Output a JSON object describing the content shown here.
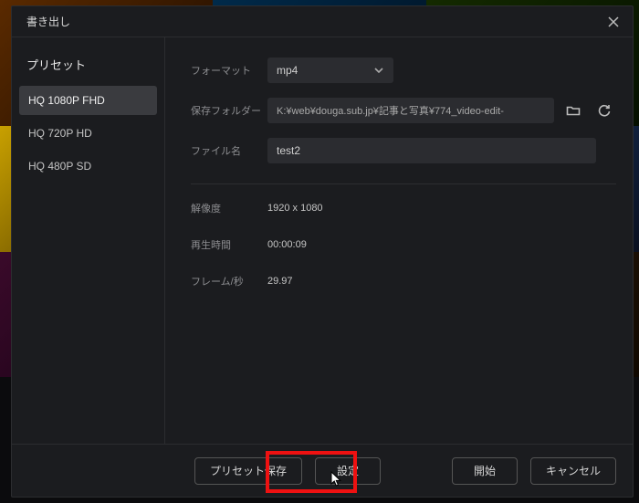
{
  "title": "書き出し",
  "sidebar": {
    "title": "プリセット",
    "presets": [
      {
        "label": "HQ 1080P FHD",
        "selected": true
      },
      {
        "label": "HQ 720P HD",
        "selected": false
      },
      {
        "label": "HQ 480P SD",
        "selected": false
      }
    ]
  },
  "form": {
    "format": {
      "label": "フォーマット",
      "value": "mp4"
    },
    "folder": {
      "label": "保存フォルダー",
      "value": "K:¥web¥douga.sub.jp¥記事と写真¥774_video-edit-"
    },
    "filename": {
      "label": "ファイル名",
      "value": "test2"
    }
  },
  "info": {
    "resolution": {
      "label": "解像度",
      "value": "1920  x  1080"
    },
    "duration": {
      "label": "再生時間",
      "value": "00:00:09"
    },
    "fps": {
      "label": "フレーム/秒",
      "value": "29.97"
    }
  },
  "footer": {
    "save_preset": "プリセット保存",
    "settings": "設定",
    "start": "開始",
    "cancel": "キャンセル"
  }
}
